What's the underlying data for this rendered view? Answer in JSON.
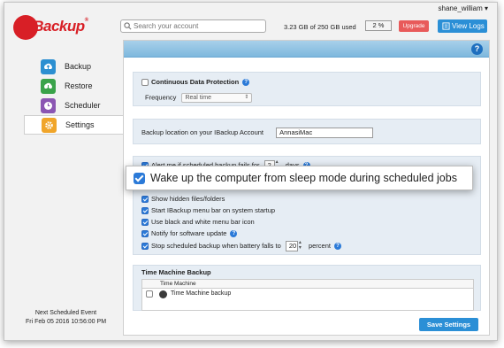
{
  "header": {
    "user": "shane_william ▾",
    "logo_text": "IBackup",
    "logo_reg": "®",
    "search_placeholder": "Search your account",
    "usage": "3.23 GB of 250 GB used",
    "percent": "2 %",
    "upgrade_label": "Upgrade",
    "logs_label": "View Logs"
  },
  "sidebar": {
    "items": [
      {
        "label": "Backup",
        "icon": "backup-icon"
      },
      {
        "label": "Restore",
        "icon": "restore-icon"
      },
      {
        "label": "Scheduler",
        "icon": "scheduler-icon"
      },
      {
        "label": "Settings",
        "icon": "settings-icon"
      }
    ],
    "active": "Settings",
    "next_event_label": "Next Scheduled Event",
    "next_event_time": "Fri Feb 05 2016 10:56:00 PM"
  },
  "settings": {
    "help": "?",
    "cdp_label": "Continuous Data Protection",
    "frequency_label": "Frequency",
    "frequency_value": "Real time",
    "location_label": "Backup location on your IBackup Account",
    "location_value": "AnnasiMac",
    "alert_label": "Alert me if scheduled backup fails for",
    "alert_days": "2",
    "alert_unit": "days",
    "options": [
      {
        "label": "Show hidden files/folders",
        "checked": true
      },
      {
        "label": "Start IBackup menu bar on system startup",
        "checked": true
      },
      {
        "label": "Use black and white menu bar icon",
        "checked": true
      },
      {
        "label": "Notify for software update",
        "checked": true
      }
    ],
    "battery_label": "Stop scheduled backup when battery falls to",
    "battery_value": "20",
    "battery_unit": "percent",
    "tm_title": "Time Machine Backup",
    "tm_col": "Time Machine",
    "tm_item": "Time Machine backup",
    "save_label": "Save Settings"
  },
  "callout": {
    "label": "Wake up the computer from sleep mode during scheduled jobs",
    "checked": true
  },
  "colors": {
    "accent": "#2b8fd6",
    "brand": "#d81f26",
    "upgrade": "#e85a5a",
    "panel": "#e6edf4",
    "header_band": "#7eb8dd"
  }
}
